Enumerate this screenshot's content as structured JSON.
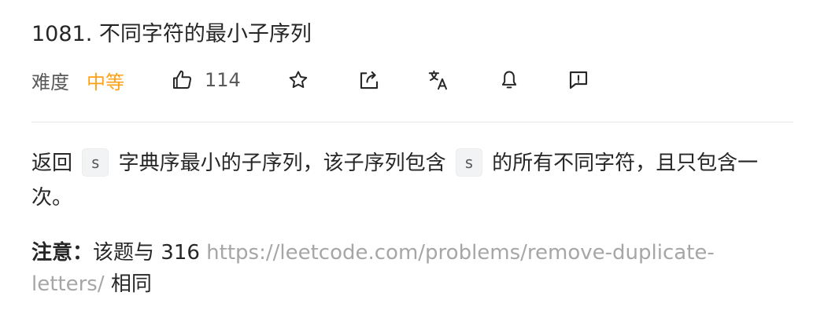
{
  "problem": {
    "title": "1081. 不同字符的最小子序列",
    "difficulty_label": "难度",
    "difficulty": "中等",
    "likes": "114"
  },
  "toolbar": {
    "icons": [
      "thumbs-up-icon",
      "star-icon",
      "share-icon",
      "translate-icon",
      "bell-icon",
      "feedback-icon"
    ]
  },
  "description": {
    "part1": "返回 ",
    "code1": "s",
    "part2": " 字典序最小的子序列，该子序列包含 ",
    "code2": "s",
    "part3": " 的所有不同字符，且只包含一次。"
  },
  "note": {
    "label": "注意：",
    "text": "该题与 316 ",
    "link": "https://leetcode.com/problems/remove-duplicate-letters/",
    "suffix": " 相同"
  },
  "colors": {
    "difficulty_medium": "#ffa116",
    "link": "#a6a6a6"
  }
}
